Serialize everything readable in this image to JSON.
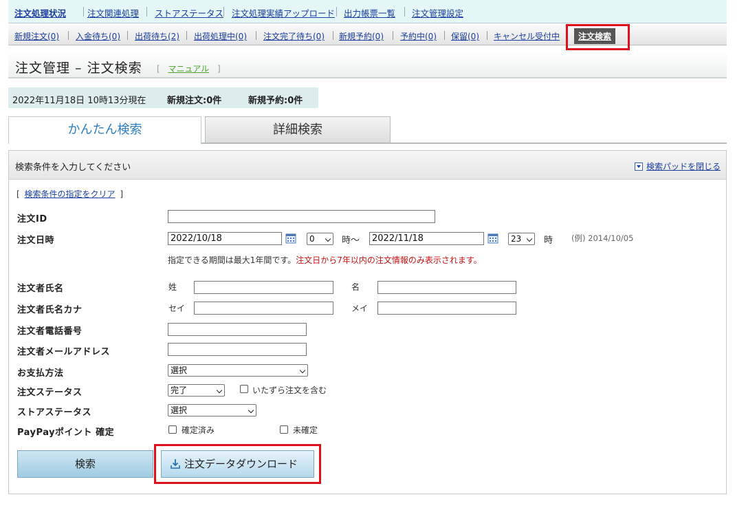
{
  "top_nav": [
    "注文処理状況",
    "注文関連処理",
    "ストアステータス",
    "注文処理実績アップロード",
    "出力帳票一覧",
    "注文管理設定"
  ],
  "sub_nav": [
    "新規注文(0)",
    "入金待ち(0)",
    "出荷待ち(2)",
    "出荷処理中(0)",
    "注文完了待ち(0)",
    "新規予約(0)",
    "予約中(0)",
    "保留(0)",
    "キャンセル受付中"
  ],
  "sub_nav_current": "注文検索",
  "page": {
    "title": "注文管理 – 注文検索",
    "manual_open": "[",
    "manual_link": "マニュアル",
    "manual_close": "]"
  },
  "status": {
    "datetime": "2022年11月18日 10時13分現在",
    "new_orders": "新規注文:0件",
    "new_reservations": "新規予約:0件"
  },
  "tabs": {
    "simple": "かんたん検索",
    "detail": "詳細検索"
  },
  "panel": {
    "heading": "検索条件を入力してください",
    "close_pad": "検索パッドを閉じる",
    "clear_open": "[",
    "clear_link": "検索条件の指定をクリア",
    "clear_close": "]"
  },
  "form": {
    "order_id_label": "注文ID",
    "order_id_value": "",
    "order_date_label": "注文日時",
    "date_from": "2022/10/18",
    "hour_from": "0",
    "hour_suffix_from": "時〜",
    "date_to": "2022/11/18",
    "hour_to": "23",
    "hour_suffix_to": "時",
    "date_example": "(例) 2014/10/05",
    "date_note": "指定できる期間は最大1年間です。",
    "date_note_red": "注文日から7年以内の注文情報のみ表示されます。",
    "name_label": "注文者氏名",
    "last_name_label": "姓",
    "first_name_label": "名",
    "kana_label": "注文者氏名カナ",
    "kana_last_label": "セイ",
    "kana_first_label": "メイ",
    "phone_label": "注文者電話番号",
    "email_label": "注文者メールアドレス",
    "payment_label": "お支払方法",
    "payment_value": "選択",
    "order_status_label": "注文ステータス",
    "order_status_value": "完了",
    "prank_label": "いたずら注文を含む",
    "store_status_label": "ストアステータス",
    "store_status_value": "選択",
    "paypay_label": "PayPayポイント 確定",
    "confirmed_label": "確定済み",
    "unconfirmed_label": "未確定"
  },
  "buttons": {
    "search": "検索",
    "download": "注文データダウンロード"
  },
  "colors": {
    "highlight_box": "#e0101a",
    "active_tab_text": "#2e7fc0",
    "note_red": "#cc1111"
  }
}
